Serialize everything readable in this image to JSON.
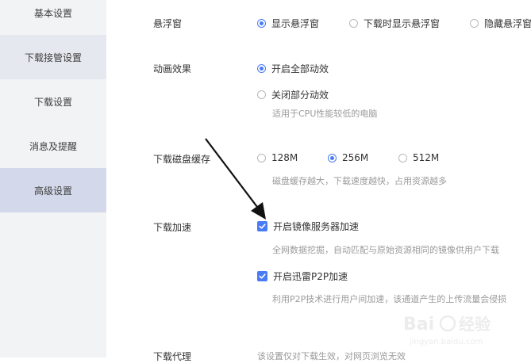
{
  "sidebar": {
    "items": [
      {
        "label": "基本设置"
      },
      {
        "label": "下载接管设置"
      },
      {
        "label": "下载设置"
      },
      {
        "label": "消息及提醒"
      },
      {
        "label": "高级设置"
      }
    ]
  },
  "floating_window": {
    "label": "悬浮窗",
    "options": [
      "显示悬浮窗",
      "下载时显示悬浮窗",
      "隐藏悬浮窗"
    ],
    "selected": "显示悬浮窗"
  },
  "animation": {
    "label": "动画效果",
    "options": [
      "开启全部动效",
      "关闭部分动效"
    ],
    "selected": "开启全部动效",
    "hint": "适用于CPU性能较低的电脑"
  },
  "disk_cache": {
    "label": "下载磁盘缓存",
    "options": [
      "128M",
      "256M",
      "512M"
    ],
    "selected": "256M",
    "hint": "磁盘缓存越大，下载速度越快，占用资源越多"
  },
  "acceleration": {
    "label": "下载加速",
    "mirror": {
      "label": "开启镜像服务器加速",
      "checked": true,
      "hint": "全网数据挖掘，自动匹配与原始资源相同的镜像供用户下载"
    },
    "p2p": {
      "label": "开启迅雷P2P加速",
      "checked": true,
      "hint": "利用P2P技术进行用户间加速，该通道产生的上传流量会侵损"
    }
  },
  "proxy": {
    "label": "下载代理",
    "hint": "该设置仅对下载生效，对网页浏览无效"
  },
  "watermark": {
    "brand": "Bai",
    "brand_cn": "经验",
    "url": "jingyan.baidu.com"
  },
  "colors": {
    "accent": "#4a7bf6",
    "sidebar_bg": "#f2f3f5",
    "active_bg": "#d3d9ea"
  }
}
